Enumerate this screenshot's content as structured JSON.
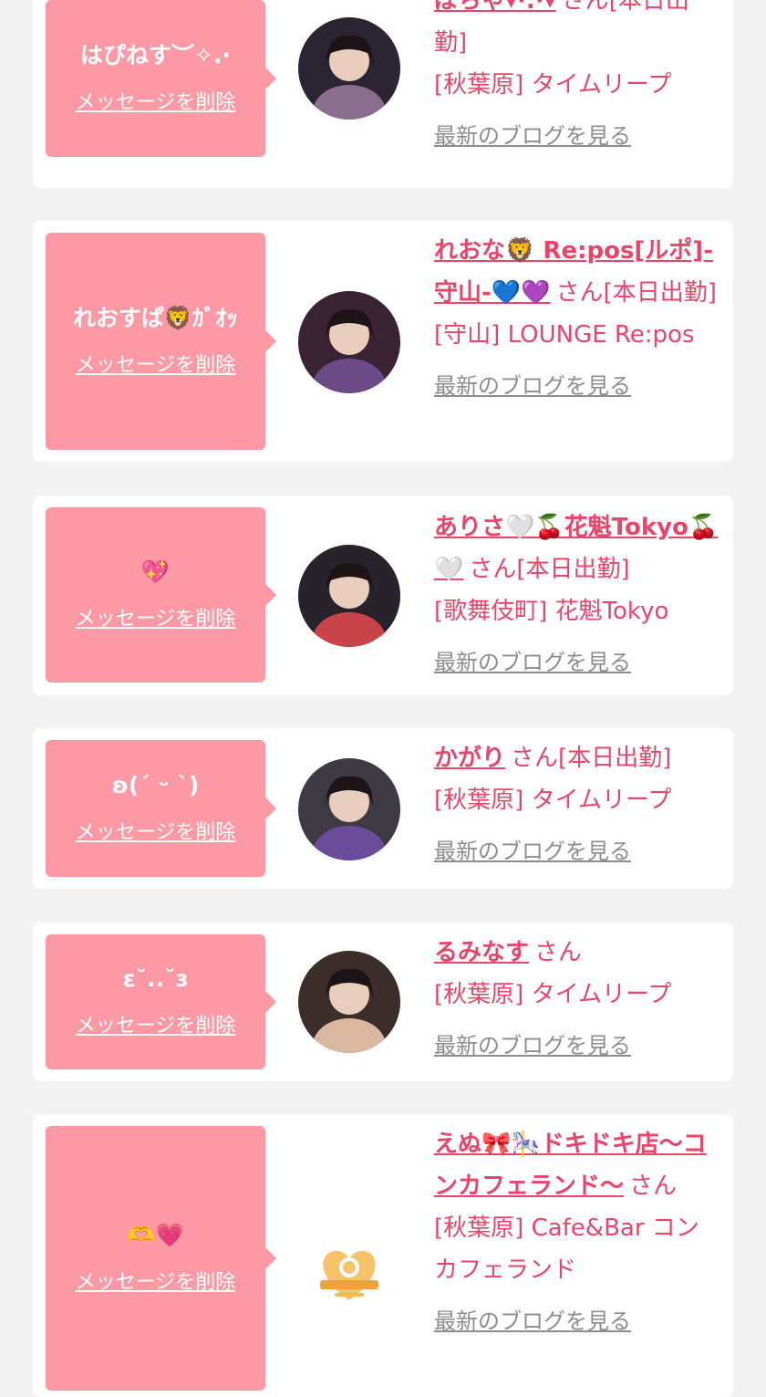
{
  "delete_label": "メッセージを削除",
  "san_label": "さん",
  "blog_label": "最新のブログを見る",
  "colors": {
    "page_background": "#f3f3f3",
    "card_background": "#ffffff",
    "bubble": "#fd98a5",
    "name_link": "#e8456a",
    "muted_link": "#8d8d8d"
  },
  "favorites": [
    {
      "message": "はぴねす︶✧.·",
      "name": "ぽちゃ▾·.·▾",
      "status": "[本日出勤]",
      "area": "[秋葉原]",
      "shop": "タイムリープ",
      "avatar_icon": "avatar-photo"
    },
    {
      "message": "れおすぱ🦁ｶﾞｵｯ",
      "name": "れおな🦁 Re:pos[ルポ]-守山-💙💜",
      "status": "[本日出勤]",
      "area": "[守山]",
      "shop": "LOUNGE Re:pos",
      "avatar_icon": "avatar-photo"
    },
    {
      "message": "💖",
      "name": "ありさ🤍🍒花魁Tokyo🍒🤍",
      "status": "[本日出勤]",
      "area": "[歌舞伎町]",
      "shop": "花魁Tokyo",
      "avatar_icon": "avatar-photo"
    },
    {
      "message": "ʚ(ˊ ᵕ ˋ)",
      "name": "かがり",
      "status": "[本日出勤]",
      "area": "[秋葉原]",
      "shop": "タイムリープ",
      "avatar_icon": "avatar-photo"
    },
    {
      "message": "ε˘..˘ɜ",
      "name": "るみなす",
      "status": "",
      "area": "[秋葉原]",
      "shop": "タイムリープ",
      "avatar_icon": "avatar-photo"
    },
    {
      "message": "🫶💗",
      "name": "えぬ🎀🎠ドキドキ店〜コンカフェランド〜",
      "status": "",
      "area": "[秋葉原]",
      "shop": "Cafe&Bar コンカフェランド",
      "avatar_icon": "heart-c-logo-icon"
    }
  ]
}
